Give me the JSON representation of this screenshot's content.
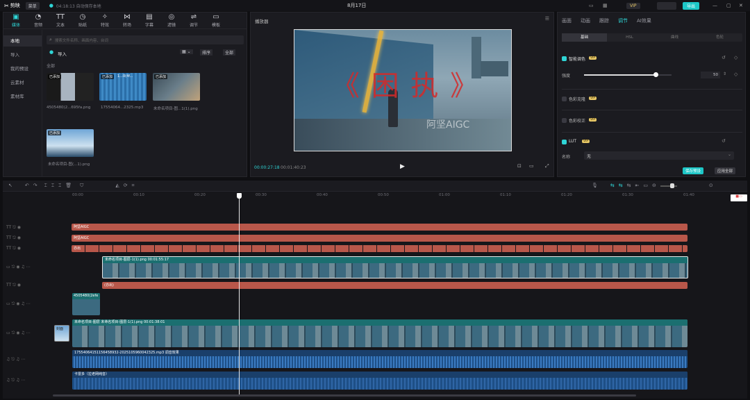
{
  "app": {
    "logo_text": "剪映",
    "menu_label": "菜单",
    "project_status": "04:18:13 自动保存本地",
    "window_title": "8月17日",
    "vip_button": "VIP",
    "share_button": "",
    "export_button": "导出"
  },
  "toolbar": {
    "items": [
      {
        "label": "媒体",
        "icon": "media-icon"
      },
      {
        "label": "音频",
        "icon": "audio-icon"
      },
      {
        "label": "文本",
        "icon": "text-icon"
      },
      {
        "label": "贴纸",
        "icon": "sticker-icon"
      },
      {
        "label": "特效",
        "icon": "effects-icon"
      },
      {
        "label": "转场",
        "icon": "transition-icon"
      },
      {
        "label": "字幕",
        "icon": "subtitle-icon"
      },
      {
        "label": "滤镜",
        "icon": "filter-icon"
      },
      {
        "label": "调节",
        "icon": "adjust-icon"
      },
      {
        "label": "模板",
        "icon": "template-icon"
      }
    ]
  },
  "media_sidebar": {
    "items": [
      "本地",
      "导入",
      "我的预设",
      "云素材",
      "素材库"
    ]
  },
  "media_panel": {
    "search_placeholder": "搜索文件名称、画面内容、台词",
    "import_label": "导入",
    "sort_label": "排序",
    "filter_label": "全部",
    "section_label": "全部",
    "added_badge": "已添加",
    "items": [
      {
        "caption": "4505480(2...695fa.png"
      },
      {
        "caption": "17554064...2325.mp3",
        "overlay": "1...0(4f..."
      },
      {
        "caption": "未命名项目-图...1(1).png"
      },
      {
        "caption": "未命名项目-图(...1).png"
      }
    ]
  },
  "player": {
    "title": "播放器",
    "title_text": "《 困 执 》",
    "watermark": "阿坚AIGC",
    "current_time": "00:00:27:18",
    "total_time": "00:01:40:23"
  },
  "inspector": {
    "tabs": [
      "画面",
      "动画",
      "跟踪",
      "调节",
      "AI效果"
    ],
    "active_tab": "调节",
    "subtabs": [
      "基础",
      "HSL",
      "曲线",
      "色轮"
    ],
    "section1": "智能调色",
    "vip": "VIP",
    "intensity_label": "强度",
    "intensity_value": "50",
    "intensity_level": 0.82,
    "section2": "色彩克隆",
    "section3": "色彩校正",
    "section4": "LUT",
    "name_label": "名称",
    "name_value": "无",
    "save_preset": "保存预设",
    "apply_all": "应用全部"
  },
  "timeline": {
    "ruler": [
      "00:00",
      "00:10",
      "00:20",
      "00:30",
      "00:40",
      "00:50",
      "01:00",
      "01:10",
      "01:20",
      "01:30",
      "01:40"
    ],
    "playhead_ratio": 0.27,
    "clips": {
      "text1": "阿坚AIGC",
      "text2": "阿坚AIGC",
      "text3": "亦出",
      "video_overlay": "未命名项目-图层-1(1).png  00:01:55:17",
      "text4": "(亦出)",
      "small_clip": "4505480(2efe",
      "main_video": "未命名项目-图层  未命名项目-图层-1(1).png  00:01:38:01",
      "cover": "封面",
      "audio1": "17554064151156458932-2025105960042325.mp3    调音效果",
      "audio2": "卡雷多（拉老网纯音）"
    }
  }
}
